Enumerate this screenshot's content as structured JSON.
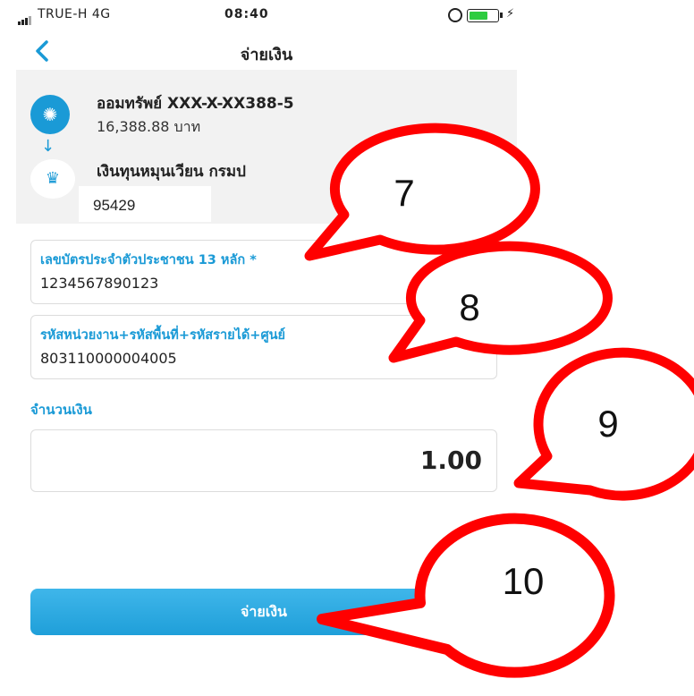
{
  "status_bar": {
    "carrier": "TRUE-H  4G",
    "time": "08:40"
  },
  "nav": {
    "title": "จ่ายเงิน",
    "back_icon": "chevron-left-icon"
  },
  "from_account": {
    "name": "ออมทรัพย์ XXX-X-XX388-5",
    "balance": "16,388.88 บาท"
  },
  "biller": {
    "name": "เงินทุนหมุนเวียน กรมป",
    "code": "95429"
  },
  "fields": {
    "id_card": {
      "label": "เลขบัตรประจำตัวประชาชน 13 หลัก *",
      "value": "1234567890123"
    },
    "codes": {
      "label": "รหัสหน่วยงาน+รหัสพื้นที่+รหัสรายได้+ศูนย์",
      "value": "803110000004005"
    }
  },
  "amount": {
    "label": "จำนวนเงิน",
    "value": "1.00"
  },
  "pay_button": {
    "label": "จ่ายเงิน"
  },
  "callouts": [
    "7",
    "8",
    "9",
    "10"
  ],
  "colors": {
    "accent": "#1a9ad6",
    "callout": "#ff0000"
  }
}
